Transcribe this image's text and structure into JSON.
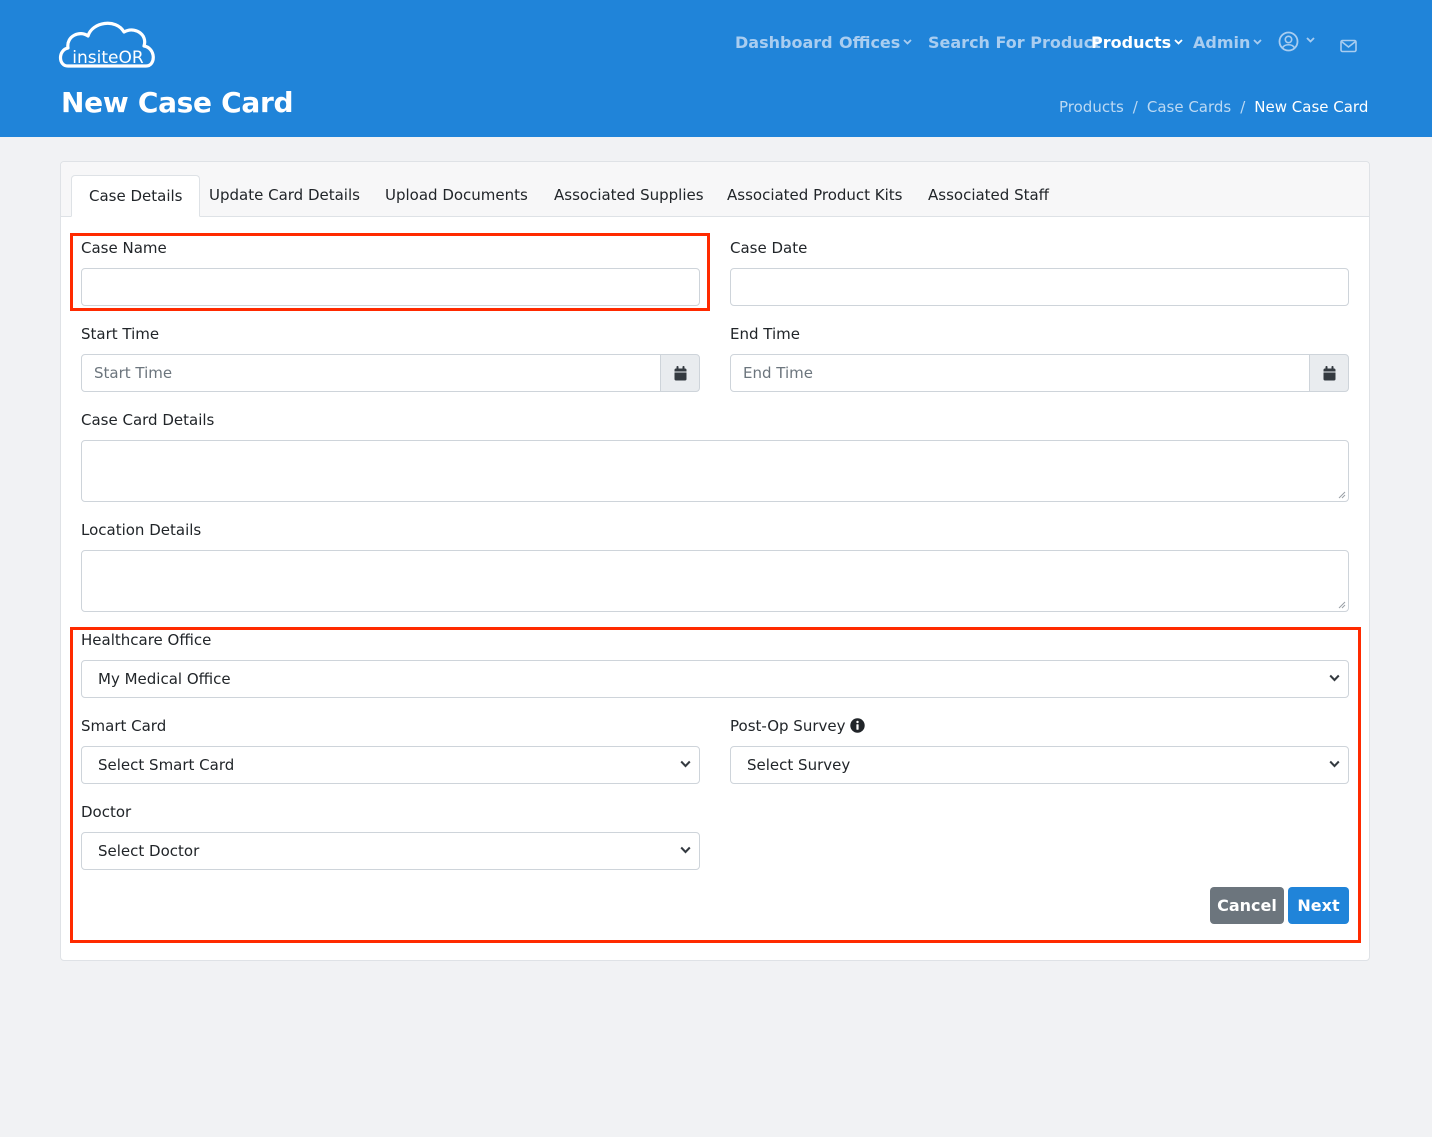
{
  "app": {
    "logo_text": "insiteOR",
    "page_title": "New Case Card"
  },
  "nav": {
    "dashboard": "Dashboard",
    "offices": "Offices",
    "search": "Search For Product",
    "products": "Products",
    "admin": "Admin"
  },
  "breadcrumb": {
    "products": "Products",
    "case_cards": "Case Cards",
    "current": "New Case Card",
    "separator": "/"
  },
  "tabs": [
    {
      "label": "Case Details"
    },
    {
      "label": "Update Card Details"
    },
    {
      "label": "Upload Documents"
    },
    {
      "label": "Associated Supplies"
    },
    {
      "label": "Associated Product Kits"
    },
    {
      "label": "Associated Staff"
    }
  ],
  "form": {
    "case_name": {
      "label": "Case Name",
      "value": ""
    },
    "case_date": {
      "label": "Case Date",
      "value": ""
    },
    "start_time": {
      "label": "Start Time",
      "placeholder": "Start Time",
      "value": ""
    },
    "end_time": {
      "label": "End Time",
      "placeholder": "End Time",
      "value": ""
    },
    "case_card_details": {
      "label": "Case Card Details",
      "value": ""
    },
    "location_details": {
      "label": "Location Details",
      "value": ""
    },
    "healthcare_office": {
      "label": "Healthcare Office",
      "selected": "My Medical Office"
    },
    "smart_card": {
      "label": "Smart Card",
      "selected": "Select Smart Card"
    },
    "post_op_survey": {
      "label": "Post-Op Survey",
      "selected": "Select Survey"
    },
    "doctor": {
      "label": "Doctor",
      "selected": "Select Doctor"
    }
  },
  "buttons": {
    "cancel": "Cancel",
    "next": "Next"
  },
  "colors": {
    "header_bg": "#2084d9",
    "highlight": "#ff2a00",
    "cancel_bg": "#6c757d",
    "next_bg": "#2084d9"
  }
}
